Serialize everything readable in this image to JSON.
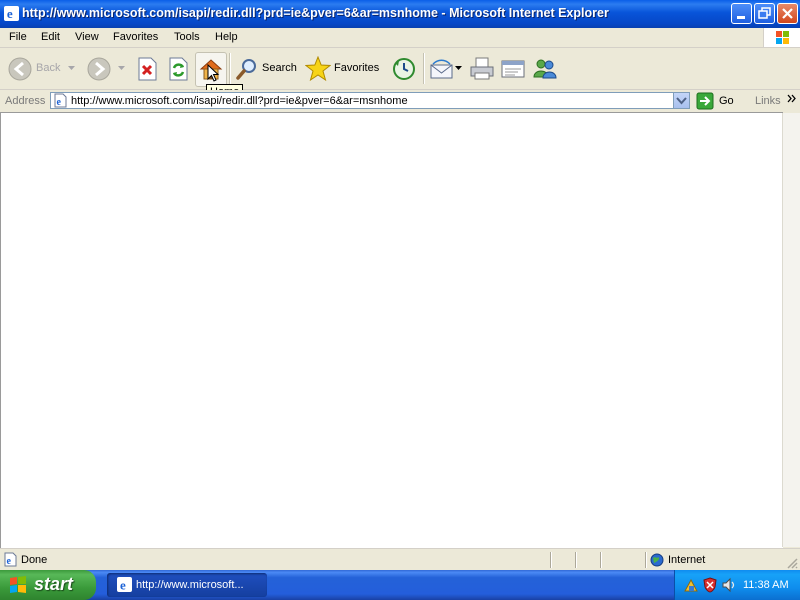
{
  "window": {
    "title": "http://www.microsoft.com/isapi/redir.dll?prd=ie&pver=6&ar=msnhome - Microsoft Internet Explorer"
  },
  "menubar": {
    "items": [
      "File",
      "Edit",
      "View",
      "Favorites",
      "Tools",
      "Help"
    ]
  },
  "toolbar": {
    "back_label": "Back",
    "search_label": "Search",
    "favorites_label": "Favorites",
    "tooltip": "Home"
  },
  "address": {
    "label": "Address",
    "url": "http://www.microsoft.com/isapi/redir.dll?prd=ie&pver=6&ar=msnhome",
    "go_label": "Go",
    "links_label": "Links"
  },
  "status": {
    "text": "Done",
    "zone": "Internet"
  },
  "taskbar": {
    "start_label": "start",
    "task_label": "http://www.microsoft...",
    "clock": "11:38 AM"
  },
  "colors": {
    "titlebar": "#0854d9",
    "taskbar": "#245edb",
    "start": "#3a9a3a",
    "tray": "#0f8ded"
  }
}
